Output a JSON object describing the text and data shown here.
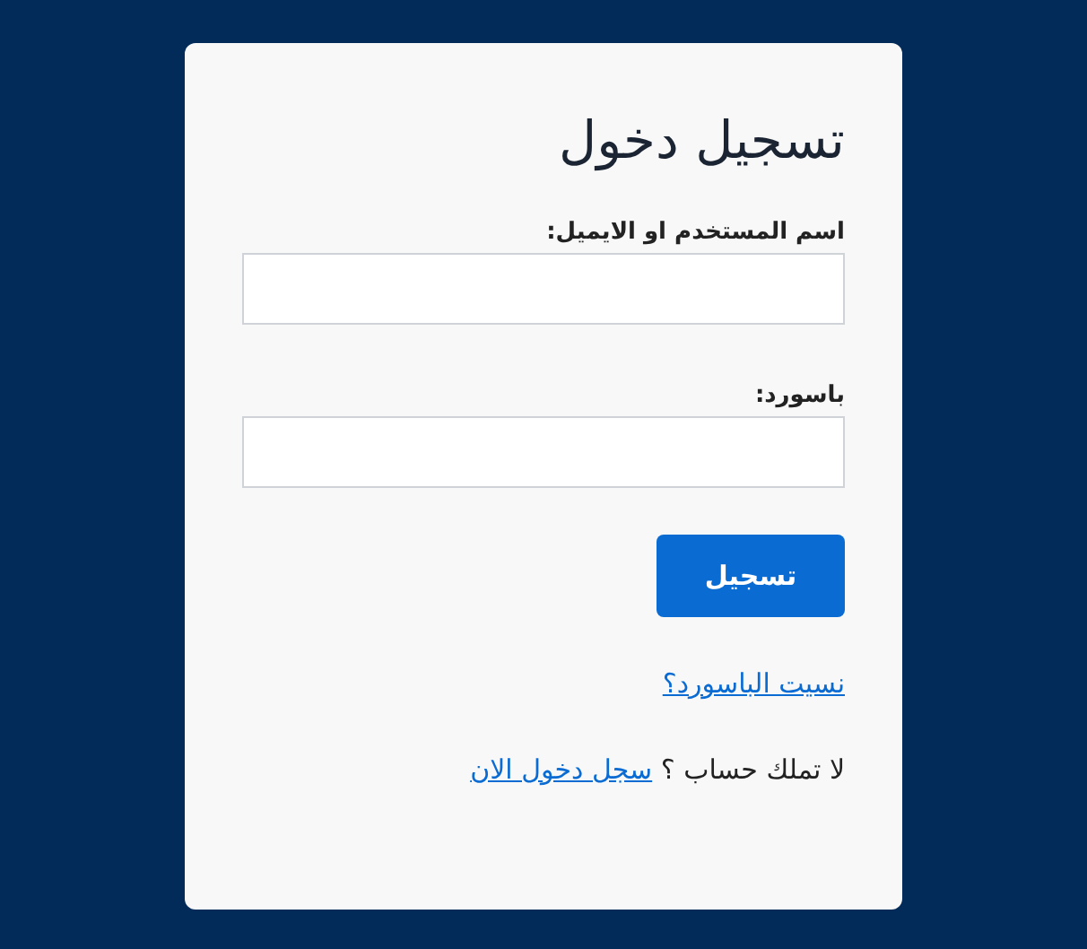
{
  "title": "تسجيل دخول",
  "fields": [
    {
      "label": "اسم المستخدم او الايميل:"
    },
    {
      "label": "باسورد:"
    }
  ],
  "submit_button": "تسجيل",
  "forgot_link": "نسيت الباسورد؟",
  "signup": {
    "text": "لا تملك حساب ؟",
    "link": "سجل دخول الان"
  }
}
